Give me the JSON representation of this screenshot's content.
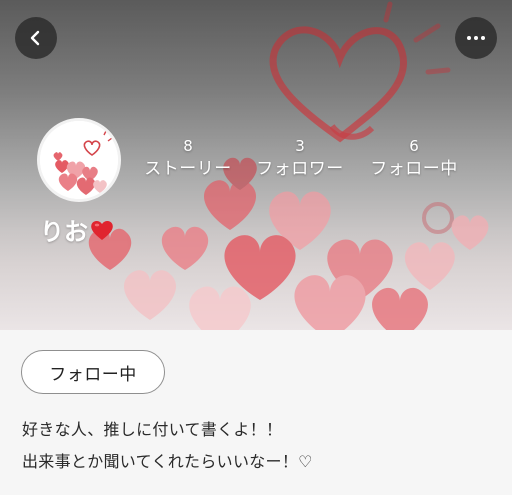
{
  "header": {
    "back_icon": "chevron-left-icon",
    "more_icon": "more-horizontal-icon",
    "heart_color": "#d9383f"
  },
  "profile": {
    "name": "りお",
    "name_emoji": "heart-emoji",
    "stats": [
      {
        "value": "8",
        "label": "ストーリー"
      },
      {
        "value": "3",
        "label": "フォロワー"
      },
      {
        "value": "6",
        "label": "フォロー中"
      }
    ]
  },
  "actions": {
    "follow_label": "フォロー中"
  },
  "bio": {
    "lines": [
      "好きな人、推しに付いて書くよ！！",
      "出来事とか聞いてくれたらいいなー！♡"
    ]
  }
}
